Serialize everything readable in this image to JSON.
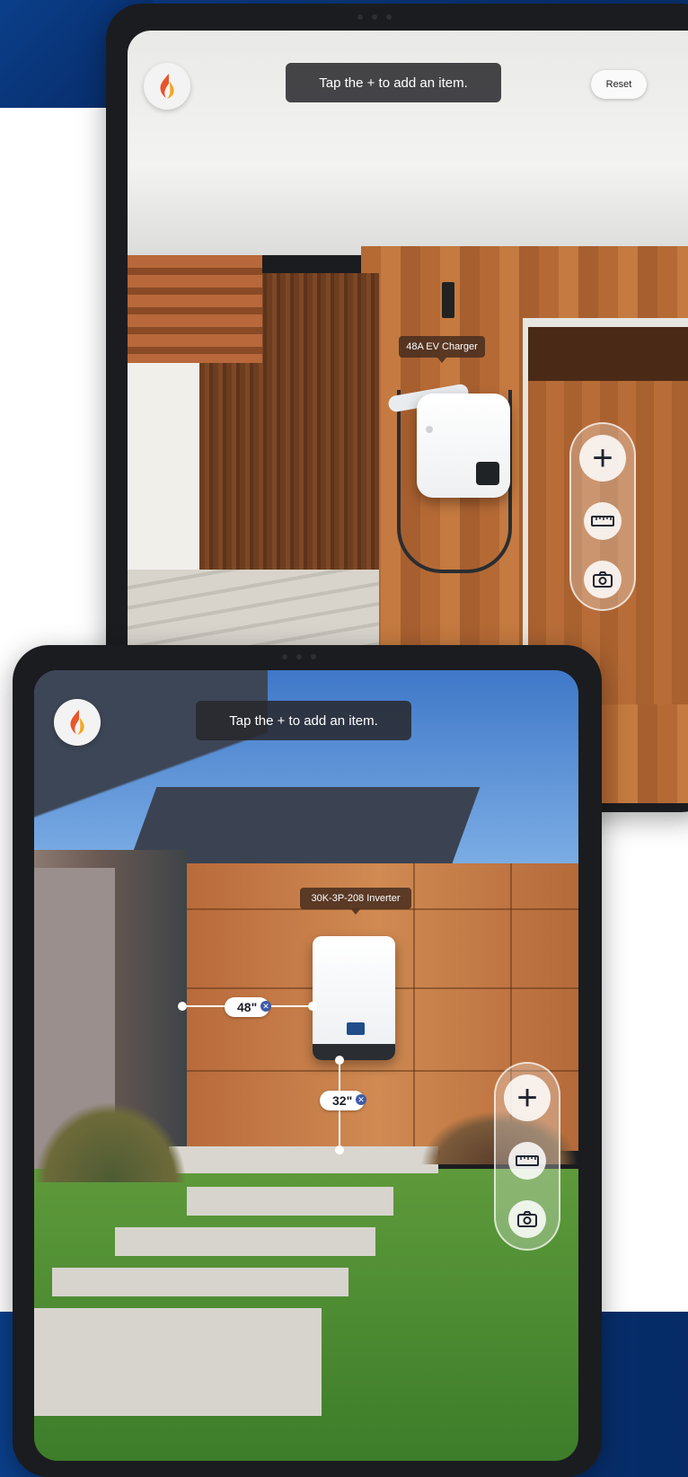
{
  "theme": {
    "brand_blue": "#0b3f8a",
    "toast_bg": "#2a2a2e",
    "tag_bg": "#462d1e"
  },
  "top_screen": {
    "instruction_toast": "Tap the + to add an item.",
    "reset_button": "Reset",
    "placed_item_label": "48A EV Charger",
    "toolbar": {
      "add_icon": "plus-icon",
      "measure_icon": "ruler-icon",
      "camera_icon": "camera-icon"
    }
  },
  "bottom_screen": {
    "instruction_toast": "Tap the + to add an item.",
    "placed_item_label": "30K-3P-208 Inverter",
    "measurements": [
      {
        "value": "48\"",
        "orientation": "horizontal"
      },
      {
        "value": "32\"",
        "orientation": "vertical"
      }
    ],
    "toolbar": {
      "add_icon": "plus-icon",
      "measure_icon": "ruler-icon",
      "camera_icon": "camera-icon"
    }
  },
  "logo_icon": "flame-logo-icon"
}
